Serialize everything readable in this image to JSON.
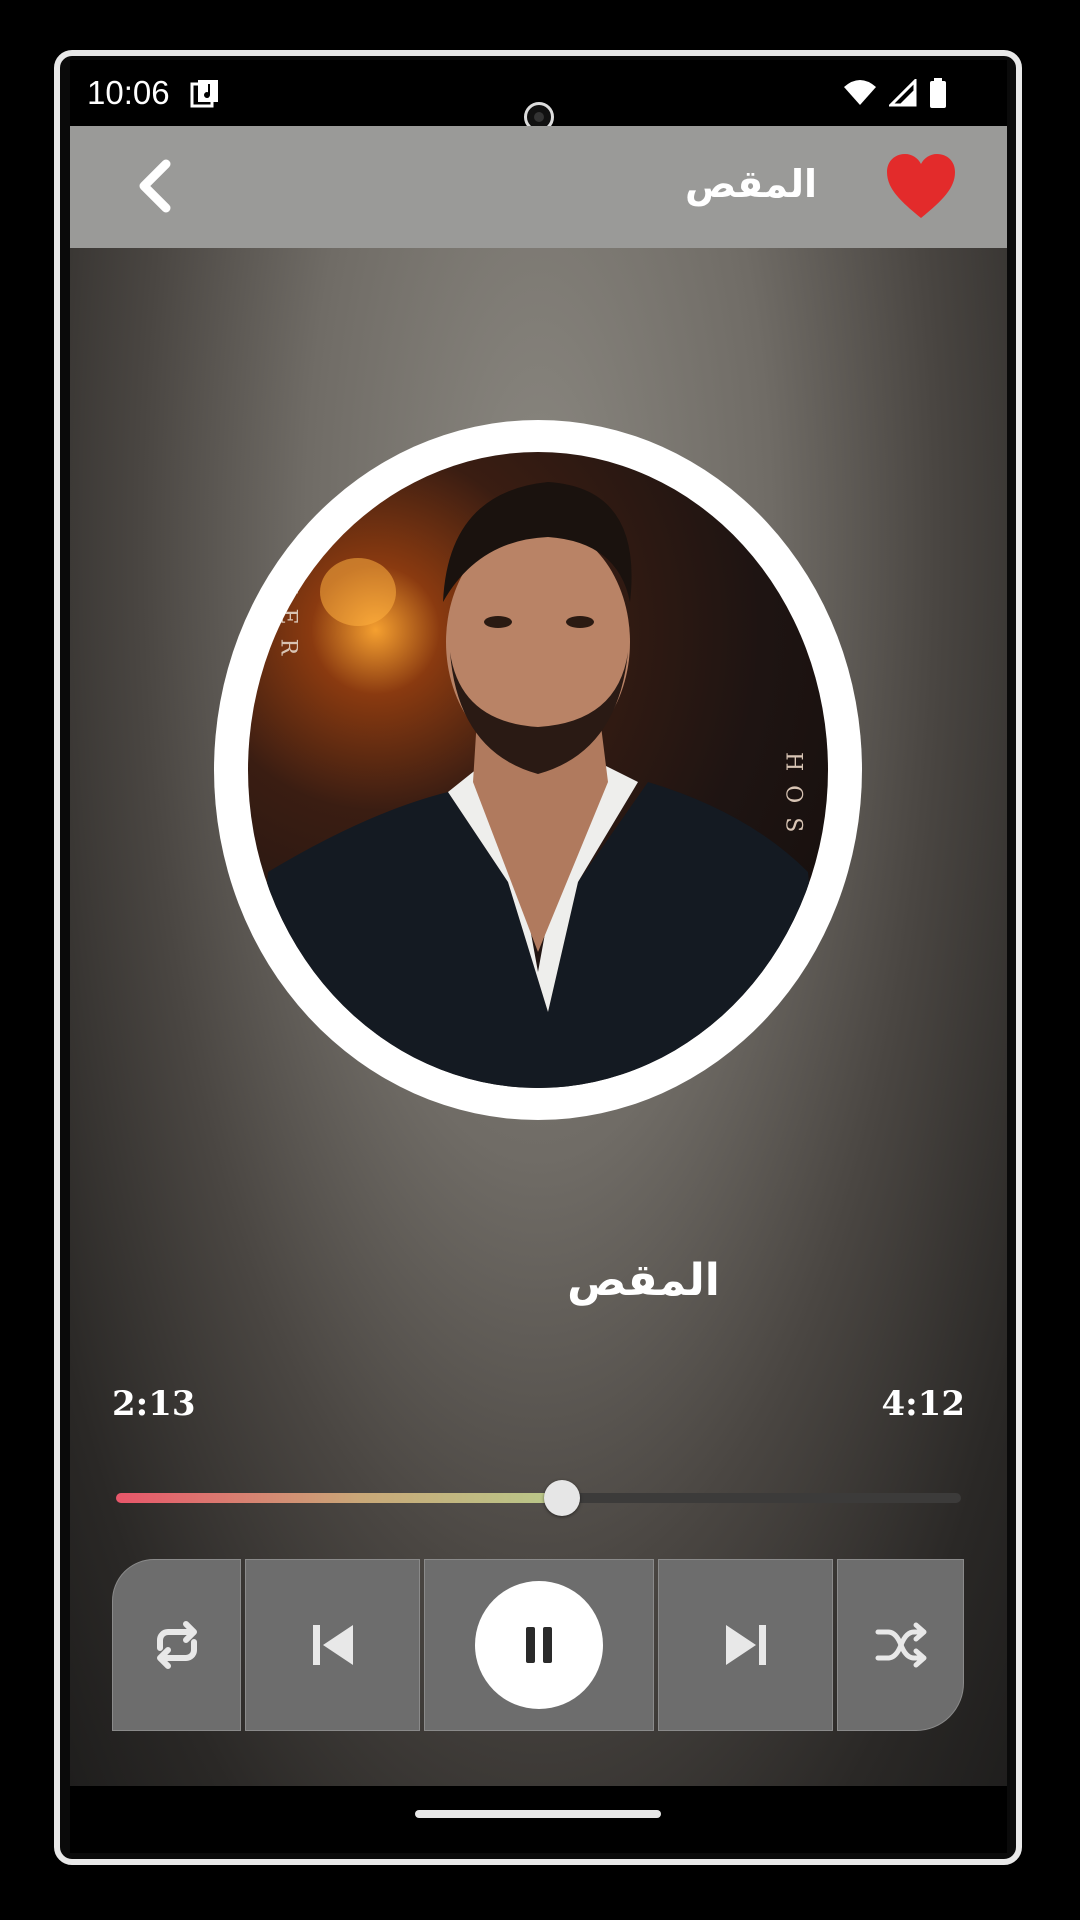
{
  "status_bar": {
    "time": "10:06",
    "icons": [
      "music-notification-icon",
      "wifi-icon",
      "signal-icon",
      "battery-icon"
    ]
  },
  "app_bar": {
    "title": "المقص",
    "back_icon": "chevron-left-icon",
    "favorite_icon": "heart-icon",
    "favorite_color": "#e32b2b"
  },
  "album_art": {
    "ring_text_left": "MER",
    "ring_text_right": "HOS"
  },
  "player": {
    "song_title": "المقص",
    "current_time": "2:13",
    "total_time": "4:12",
    "progress_fraction": 0.528,
    "state": "playing"
  },
  "controls": {
    "repeat_icon": "repeat-icon",
    "previous_icon": "skip-previous-icon",
    "play_pause_icon": "pause-icon",
    "next_icon": "skip-next-icon",
    "shuffle_icon": "shuffle-icon"
  },
  "colors": {
    "seek_start": "#e8566a",
    "seek_end": "#b9c98a",
    "control_bg": "#6d6d6d",
    "app_bar_bg": "#9a9a98"
  }
}
